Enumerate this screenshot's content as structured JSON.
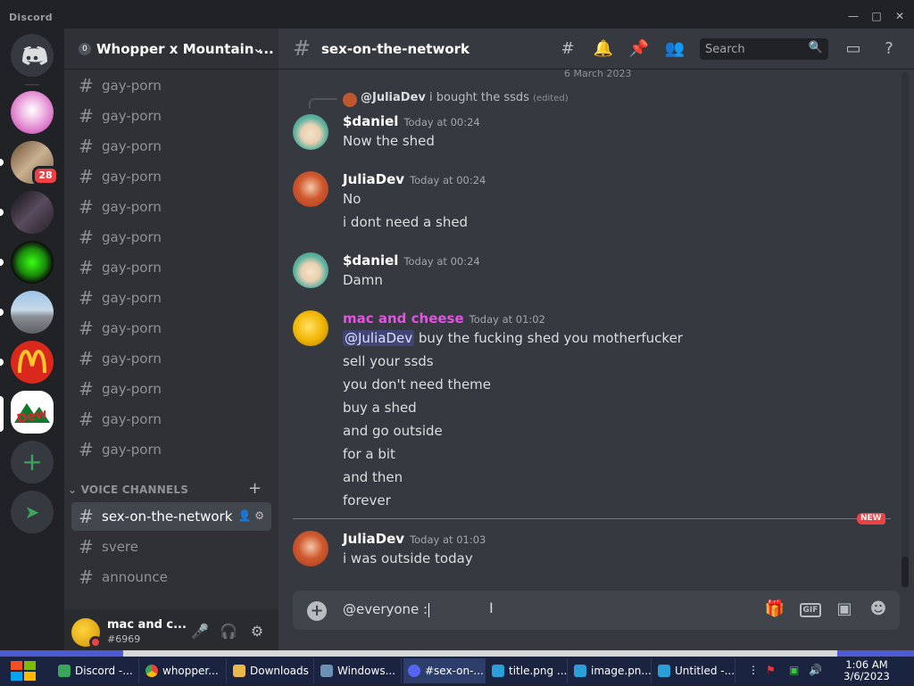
{
  "app": {
    "title": "Discord"
  },
  "server": {
    "name": "Whopper x Mountain ...",
    "badge": "0"
  },
  "channels": {
    "text": [
      "gay-porn",
      "gay-porn",
      "gay-porn",
      "gay-porn",
      "gay-porn",
      "gay-porn",
      "gay-porn",
      "gay-porn",
      "gay-porn",
      "gay-porn",
      "gay-porn",
      "gay-porn",
      "gay-porn"
    ],
    "voice_category": "VOICE CHANNELS",
    "voice": [
      {
        "name": "sex-on-the-network",
        "active": true
      },
      {
        "name": "svere",
        "active": false
      },
      {
        "name": "announce",
        "active": false
      }
    ]
  },
  "guilds": {
    "badge_count": "28"
  },
  "user": {
    "name": "mac and c...",
    "tag": "#6969"
  },
  "chat": {
    "channel": "sex-on-the-network",
    "search_placeholder": "Search",
    "date_divider": "6 March 2023",
    "reply": {
      "author": "@JuliaDev",
      "text": "i bought the ssds",
      "edited": "(edited)"
    },
    "messages": [
      {
        "author": "$daniel",
        "time": "Today at 00:24",
        "color": "#ffffff",
        "lines": [
          "Now the shed"
        ]
      },
      {
        "author": "JuliaDev",
        "time": "Today at 00:24",
        "color": "#ffffff",
        "lines": [
          "No",
          "i dont need a shed"
        ]
      },
      {
        "author": "$daniel",
        "time": "Today at 00:24",
        "color": "#ffffff",
        "lines": [
          "Damn"
        ]
      },
      {
        "author": "mac and cheese",
        "time": "Today at 01:02",
        "color": "#e352e3",
        "mention": "@JuliaDev",
        "first_line_rest": "buy the fucking shed you motherfucker",
        "lines": [
          "sell your ssds",
          "you don't need theme",
          "buy a shed",
          "and go outside",
          "for a bit",
          "and then",
          "forever"
        ]
      },
      {
        "author": "JuliaDev",
        "time": "Today at 01:03",
        "color": "#ffffff",
        "lines": [
          "i was outside today"
        ]
      }
    ],
    "new_label": "NEW",
    "composer_text": "@everyone :"
  },
  "taskbar": {
    "items": [
      "Discord -...",
      "whopper...",
      "Downloads",
      "Windows...",
      "#sex-on-...",
      "title.png ...",
      "image.pn...",
      "Untitled -..."
    ],
    "time": "1:06 AM",
    "date": "3/6/2023"
  },
  "colors": {
    "accent": "#5865f2",
    "danger": "#ed4245",
    "green": "#3ba55d",
    "mention_author": "#e352e3"
  }
}
